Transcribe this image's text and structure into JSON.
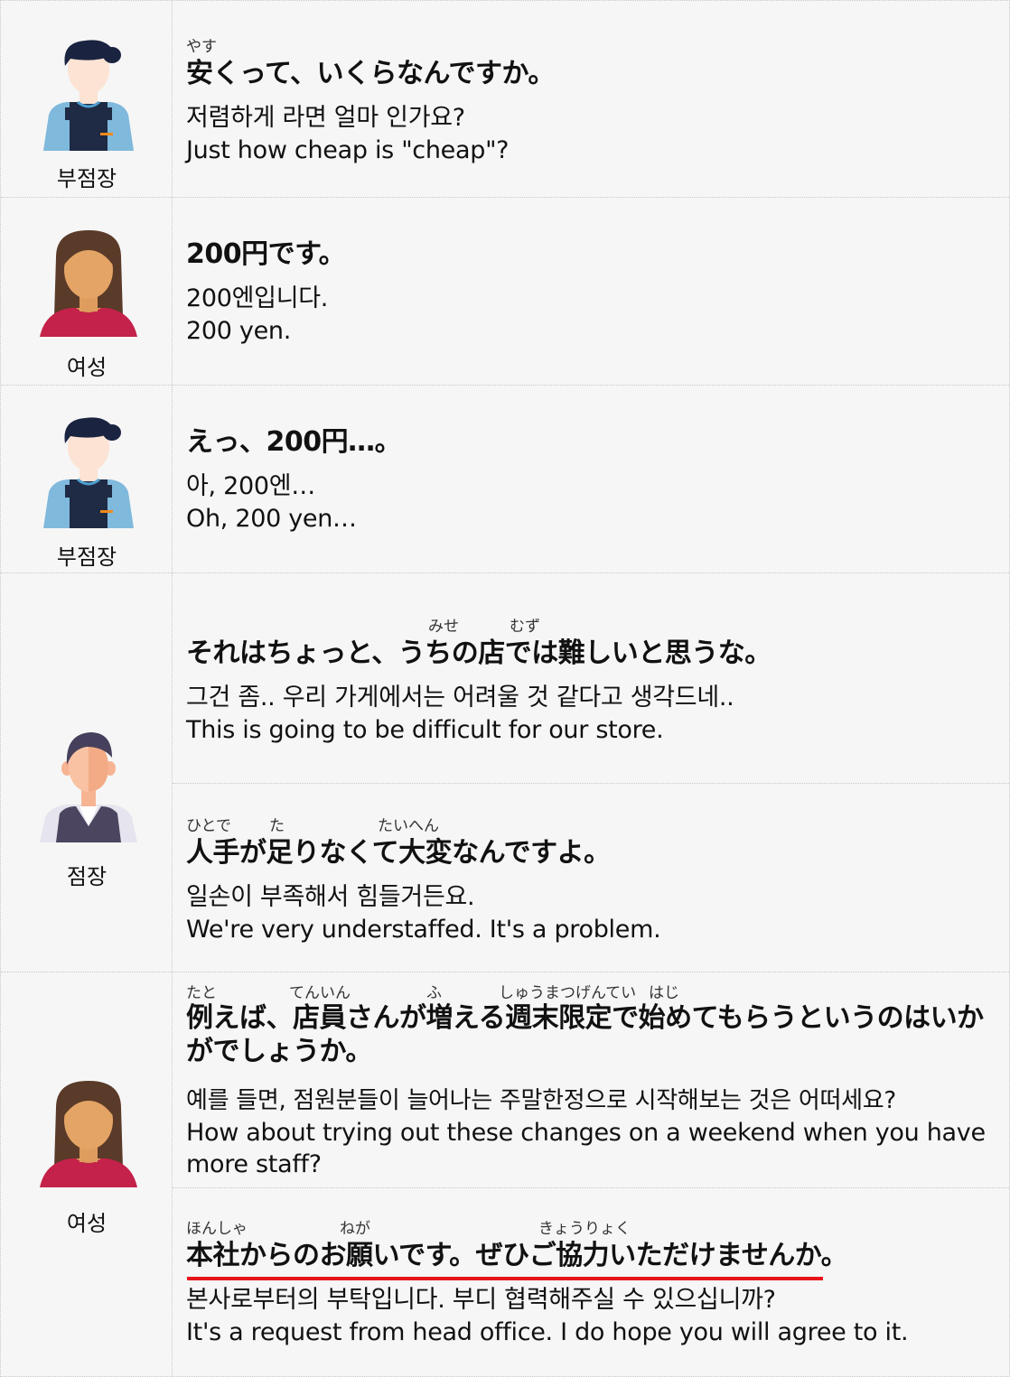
{
  "speakers": {
    "vice_manager": "부점장",
    "woman": "여성",
    "manager": "점장"
  },
  "rows": [
    {
      "ruby": [
        {
          "text": "やす"
        }
      ],
      "jp": "安くって、いくらなんですか。",
      "ko": "저렴하게 라면 얼마 인가요?",
      "en": "Just how cheap is \"cheap\"?"
    },
    {
      "jp": "200円です。",
      "ko": "200엔입니다.",
      "en": "200 yen."
    },
    {
      "jp": "えっ、200円…。",
      "ko": "아, 200엔…",
      "en": "Oh, 200 yen…"
    },
    {
      "ruby": [
        {
          "text": "みせ"
        },
        {
          "text": "むず"
        }
      ],
      "jp": "それはちょっと、うちの店では難しいと思うな。",
      "ko": "그건 좀.. 우리 가게에서는 어려울 것 같다고 생각드네..",
      "en": "This is going to be difficult for our store."
    },
    {
      "ruby": [
        {
          "text": "ひとで"
        },
        {
          "text": "た"
        },
        {
          "text": "たいへん"
        }
      ],
      "jp": "人手が足りなくて大変なんですよ。",
      "ko": "일손이 부족해서 힘들거든요.",
      "en": "We're very understaffed. It's a problem."
    },
    {
      "ruby": [
        {
          "text": "たと"
        },
        {
          "text": "てんいん"
        },
        {
          "text": "ふ"
        },
        {
          "text": "しゅうまつげんてい"
        },
        {
          "text": "はじ"
        }
      ],
      "jp": "例えば、店員さんが増える週末限定で始めてもらうというのはいかがでしょうか。",
      "ko": "예를 들면, 점원분들이 늘어나는 주말한정으로 시작해보는 것은 어떠세요?",
      "en": "How about trying out these changes on a weekend when you have more staff?"
    },
    {
      "ruby": [
        {
          "text": "ほんしゃ"
        },
        {
          "text": "ねが"
        },
        {
          "text": "きょうりょく"
        }
      ],
      "jp": "本社からのお願いです。ぜひご協力いただけませんか。",
      "ko": "본사로부터의 부탁입니다. 부디 협력해주실 수 있으십니까?",
      "en": "It's a request from head office. I do hope you will agree to it."
    }
  ],
  "colors": {
    "underline": "#e8141b",
    "background": "#f6f6f6"
  }
}
